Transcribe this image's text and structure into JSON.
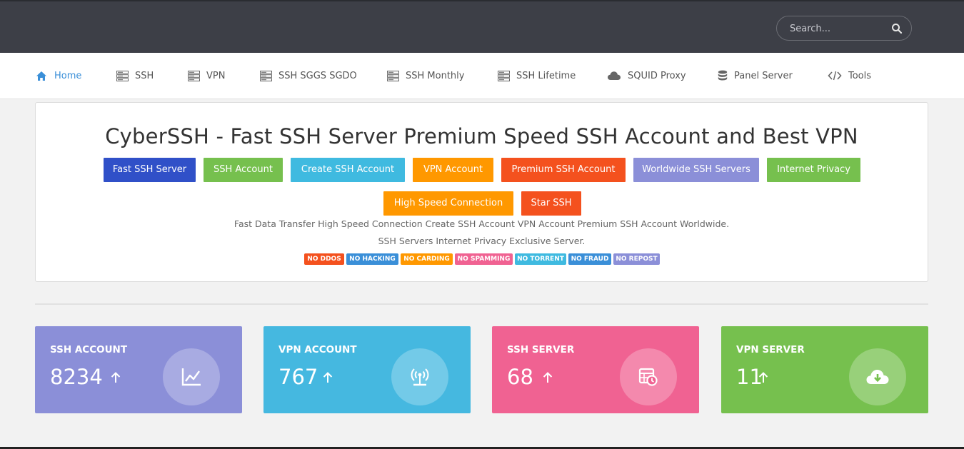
{
  "search": {
    "placeholder": "Search..."
  },
  "nav": {
    "items": [
      {
        "label": "Home",
        "icon": "home-icon"
      },
      {
        "label": "SSH",
        "icon": "server-icon"
      },
      {
        "label": "VPN",
        "icon": "server-icon"
      },
      {
        "label": "SSH SGGS SGDO",
        "icon": "server-icon"
      },
      {
        "label": "SSH Monthly",
        "icon": "server-icon"
      },
      {
        "label": "SSH Lifetime",
        "icon": "server-icon"
      },
      {
        "label": "SQUID Proxy",
        "icon": "cloud-icon"
      },
      {
        "label": "Panel Server",
        "icon": "database-icon"
      },
      {
        "label": "Tools",
        "icon": "code-icon"
      }
    ]
  },
  "hero": {
    "title": "CyberSSH - Fast SSH Server Premium Speed SSH Account and Best VPN",
    "buttons": [
      {
        "label": "Fast SSH Server",
        "color": "#3050c8"
      },
      {
        "label": "SSH Account",
        "color": "#76c04e"
      },
      {
        "label": "Create SSH Account",
        "color": "#3fbae0"
      },
      {
        "label": "VPN Account",
        "color": "#ff9800"
      },
      {
        "label": "Premium SSH Account",
        "color": "#f4511e"
      },
      {
        "label": "Worldwide SSH Servers",
        "color": "#8b8fd8"
      },
      {
        "label": "Internet Privacy",
        "color": "#76c04e"
      },
      {
        "label": "High Speed Connection",
        "color": "#ff9800"
      },
      {
        "label": "Star SSH",
        "color": "#f4511e"
      }
    ],
    "description_line1": "Fast Data Transfer High Speed Connection Create SSH Account VPN Account Premium SSH Account Worldwide.",
    "description_line2": "SSH Servers Internet Privacy Exclusive Server.",
    "badges": [
      {
        "label": "NO DDOS",
        "color": "#f4511e"
      },
      {
        "label": "NO HACKING",
        "color": "#3a8fd8"
      },
      {
        "label": "NO CARDING",
        "color": "#ff9800"
      },
      {
        "label": "NO SPAMMING",
        "color": "#f06292"
      },
      {
        "label": "NO TORRENT",
        "color": "#3fbae0"
      },
      {
        "label": "NO FRAUD",
        "color": "#3a8fd8"
      },
      {
        "label": "NO REPOST",
        "color": "#8b8fd8"
      }
    ]
  },
  "stats": [
    {
      "title": "SSH ACCOUNT",
      "value": "8234",
      "color": "#8b8fd8",
      "icon": "line-chart-icon"
    },
    {
      "title": "VPN ACCOUNT",
      "value": "767",
      "color": "#45b8e0",
      "icon": "wifi-tower-icon"
    },
    {
      "title": "SSH SERVER",
      "value": "68",
      "color": "#f06292",
      "icon": "calendar-clock-icon"
    },
    {
      "title": "VPN SERVER",
      "value": "11",
      "color": "#76c04e",
      "icon": "cloud-download-icon"
    }
  ]
}
